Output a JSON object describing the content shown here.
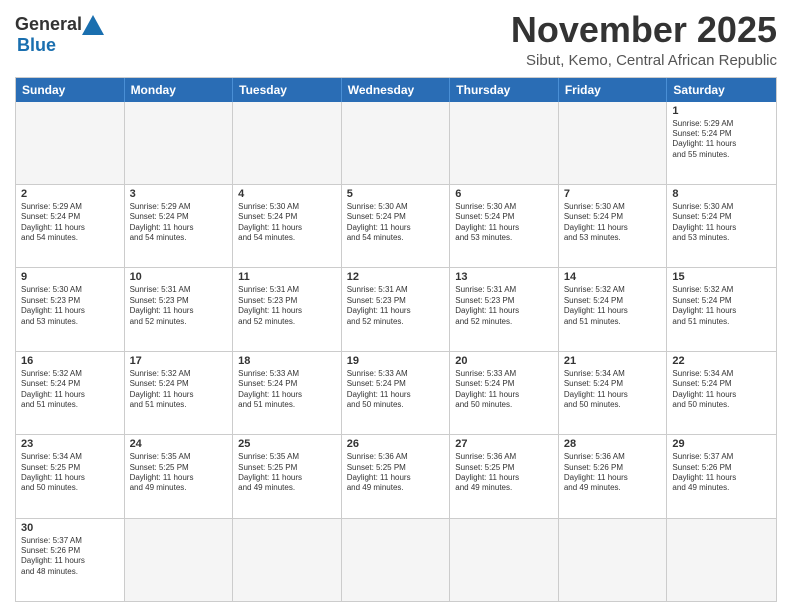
{
  "header": {
    "logo_general": "General",
    "logo_blue": "Blue",
    "month_title": "November 2025",
    "location": "Sibut, Kemo, Central African Republic"
  },
  "calendar": {
    "days_of_week": [
      "Sunday",
      "Monday",
      "Tuesday",
      "Wednesday",
      "Thursday",
      "Friday",
      "Saturday"
    ],
    "weeks": [
      [
        {
          "day": "",
          "info": "",
          "empty": true
        },
        {
          "day": "",
          "info": "",
          "empty": true
        },
        {
          "day": "",
          "info": "",
          "empty": true
        },
        {
          "day": "",
          "info": "",
          "empty": true
        },
        {
          "day": "",
          "info": "",
          "empty": true
        },
        {
          "day": "",
          "info": "",
          "empty": true
        },
        {
          "day": "1",
          "info": "Sunrise: 5:29 AM\nSunset: 5:24 PM\nDaylight: 11 hours\nand 55 minutes."
        }
      ],
      [
        {
          "day": "2",
          "info": "Sunrise: 5:29 AM\nSunset: 5:24 PM\nDaylight: 11 hours\nand 54 minutes."
        },
        {
          "day": "3",
          "info": "Sunrise: 5:29 AM\nSunset: 5:24 PM\nDaylight: 11 hours\nand 54 minutes."
        },
        {
          "day": "4",
          "info": "Sunrise: 5:30 AM\nSunset: 5:24 PM\nDaylight: 11 hours\nand 54 minutes."
        },
        {
          "day": "5",
          "info": "Sunrise: 5:30 AM\nSunset: 5:24 PM\nDaylight: 11 hours\nand 54 minutes."
        },
        {
          "day": "6",
          "info": "Sunrise: 5:30 AM\nSunset: 5:24 PM\nDaylight: 11 hours\nand 53 minutes."
        },
        {
          "day": "7",
          "info": "Sunrise: 5:30 AM\nSunset: 5:24 PM\nDaylight: 11 hours\nand 53 minutes."
        },
        {
          "day": "8",
          "info": "Sunrise: 5:30 AM\nSunset: 5:24 PM\nDaylight: 11 hours\nand 53 minutes."
        }
      ],
      [
        {
          "day": "9",
          "info": "Sunrise: 5:30 AM\nSunset: 5:23 PM\nDaylight: 11 hours\nand 53 minutes."
        },
        {
          "day": "10",
          "info": "Sunrise: 5:31 AM\nSunset: 5:23 PM\nDaylight: 11 hours\nand 52 minutes."
        },
        {
          "day": "11",
          "info": "Sunrise: 5:31 AM\nSunset: 5:23 PM\nDaylight: 11 hours\nand 52 minutes."
        },
        {
          "day": "12",
          "info": "Sunrise: 5:31 AM\nSunset: 5:23 PM\nDaylight: 11 hours\nand 52 minutes."
        },
        {
          "day": "13",
          "info": "Sunrise: 5:31 AM\nSunset: 5:23 PM\nDaylight: 11 hours\nand 52 minutes."
        },
        {
          "day": "14",
          "info": "Sunrise: 5:32 AM\nSunset: 5:24 PM\nDaylight: 11 hours\nand 51 minutes."
        },
        {
          "day": "15",
          "info": "Sunrise: 5:32 AM\nSunset: 5:24 PM\nDaylight: 11 hours\nand 51 minutes."
        }
      ],
      [
        {
          "day": "16",
          "info": "Sunrise: 5:32 AM\nSunset: 5:24 PM\nDaylight: 11 hours\nand 51 minutes."
        },
        {
          "day": "17",
          "info": "Sunrise: 5:32 AM\nSunset: 5:24 PM\nDaylight: 11 hours\nand 51 minutes."
        },
        {
          "day": "18",
          "info": "Sunrise: 5:33 AM\nSunset: 5:24 PM\nDaylight: 11 hours\nand 51 minutes."
        },
        {
          "day": "19",
          "info": "Sunrise: 5:33 AM\nSunset: 5:24 PM\nDaylight: 11 hours\nand 50 minutes."
        },
        {
          "day": "20",
          "info": "Sunrise: 5:33 AM\nSunset: 5:24 PM\nDaylight: 11 hours\nand 50 minutes."
        },
        {
          "day": "21",
          "info": "Sunrise: 5:34 AM\nSunset: 5:24 PM\nDaylight: 11 hours\nand 50 minutes."
        },
        {
          "day": "22",
          "info": "Sunrise: 5:34 AM\nSunset: 5:24 PM\nDaylight: 11 hours\nand 50 minutes."
        }
      ],
      [
        {
          "day": "23",
          "info": "Sunrise: 5:34 AM\nSunset: 5:25 PM\nDaylight: 11 hours\nand 50 minutes."
        },
        {
          "day": "24",
          "info": "Sunrise: 5:35 AM\nSunset: 5:25 PM\nDaylight: 11 hours\nand 49 minutes."
        },
        {
          "day": "25",
          "info": "Sunrise: 5:35 AM\nSunset: 5:25 PM\nDaylight: 11 hours\nand 49 minutes."
        },
        {
          "day": "26",
          "info": "Sunrise: 5:36 AM\nSunset: 5:25 PM\nDaylight: 11 hours\nand 49 minutes."
        },
        {
          "day": "27",
          "info": "Sunrise: 5:36 AM\nSunset: 5:25 PM\nDaylight: 11 hours\nand 49 minutes."
        },
        {
          "day": "28",
          "info": "Sunrise: 5:36 AM\nSunset: 5:26 PM\nDaylight: 11 hours\nand 49 minutes."
        },
        {
          "day": "29",
          "info": "Sunrise: 5:37 AM\nSunset: 5:26 PM\nDaylight: 11 hours\nand 49 minutes."
        }
      ],
      [
        {
          "day": "30",
          "info": "Sunrise: 5:37 AM\nSunset: 5:26 PM\nDaylight: 11 hours\nand 48 minutes."
        },
        {
          "day": "",
          "info": "",
          "empty": true
        },
        {
          "day": "",
          "info": "",
          "empty": true
        },
        {
          "day": "",
          "info": "",
          "empty": true
        },
        {
          "day": "",
          "info": "",
          "empty": true
        },
        {
          "day": "",
          "info": "",
          "empty": true
        },
        {
          "day": "",
          "info": "",
          "empty": true
        }
      ]
    ]
  }
}
